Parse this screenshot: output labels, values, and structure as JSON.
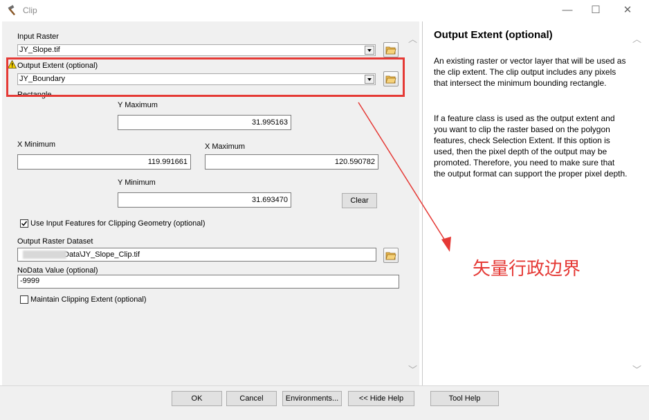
{
  "window": {
    "title": "Clip",
    "minimize": "—",
    "maximize": "☐",
    "close": "✕"
  },
  "form": {
    "input_raster_label": "Input Raster",
    "input_raster_value": "JY_Slope.tif",
    "output_extent_label": "Output Extent (optional)",
    "output_extent_value": "JY_Boundary",
    "rectangle_label": "Rectangle",
    "y_max_label": "Y Maximum",
    "y_max_value": "31.995163",
    "x_min_label": "X Minimum",
    "x_min_value": "119.991661",
    "x_max_label": "X Maximum",
    "x_max_value": "120.590782",
    "y_min_label": "Y Minimum",
    "y_min_value": "31.693470",
    "clear_label": "Clear",
    "use_input_label": "Use Input Features for Clipping Geometry (optional)",
    "use_input_checked": true,
    "output_dataset_label": "Output Raster Dataset",
    "output_dataset_value": "Data\\JY_Slope_Clip.tif",
    "nodata_label": "NoData Value (optional)",
    "nodata_value": "-9999",
    "maintain_label": "Maintain Clipping Extent (optional)",
    "maintain_checked": false
  },
  "help": {
    "title": "Output Extent (optional)",
    "para1": "An existing raster or vector layer that will be used as the clip extent. The clip output includes any pixels that intersect the minimum bounding rectangle.",
    "para2": "If a feature class is used as the output extent and you want to clip the raster based on the polygon features, check Selection Extent. If this option is used, then the pixel depth of the output may be promoted. Therefore, you need to make sure that the output format can support the proper pixel depth."
  },
  "buttons": {
    "ok": "OK",
    "cancel": "Cancel",
    "environments": "Environments...",
    "hide_help": "<< Hide Help",
    "tool_help": "Tool Help"
  },
  "annotation": {
    "text": "矢量行政边界",
    "color": "#e53935"
  },
  "colors": {
    "dialog_bg": "#f0f0f0",
    "highlight": "#e53935"
  }
}
